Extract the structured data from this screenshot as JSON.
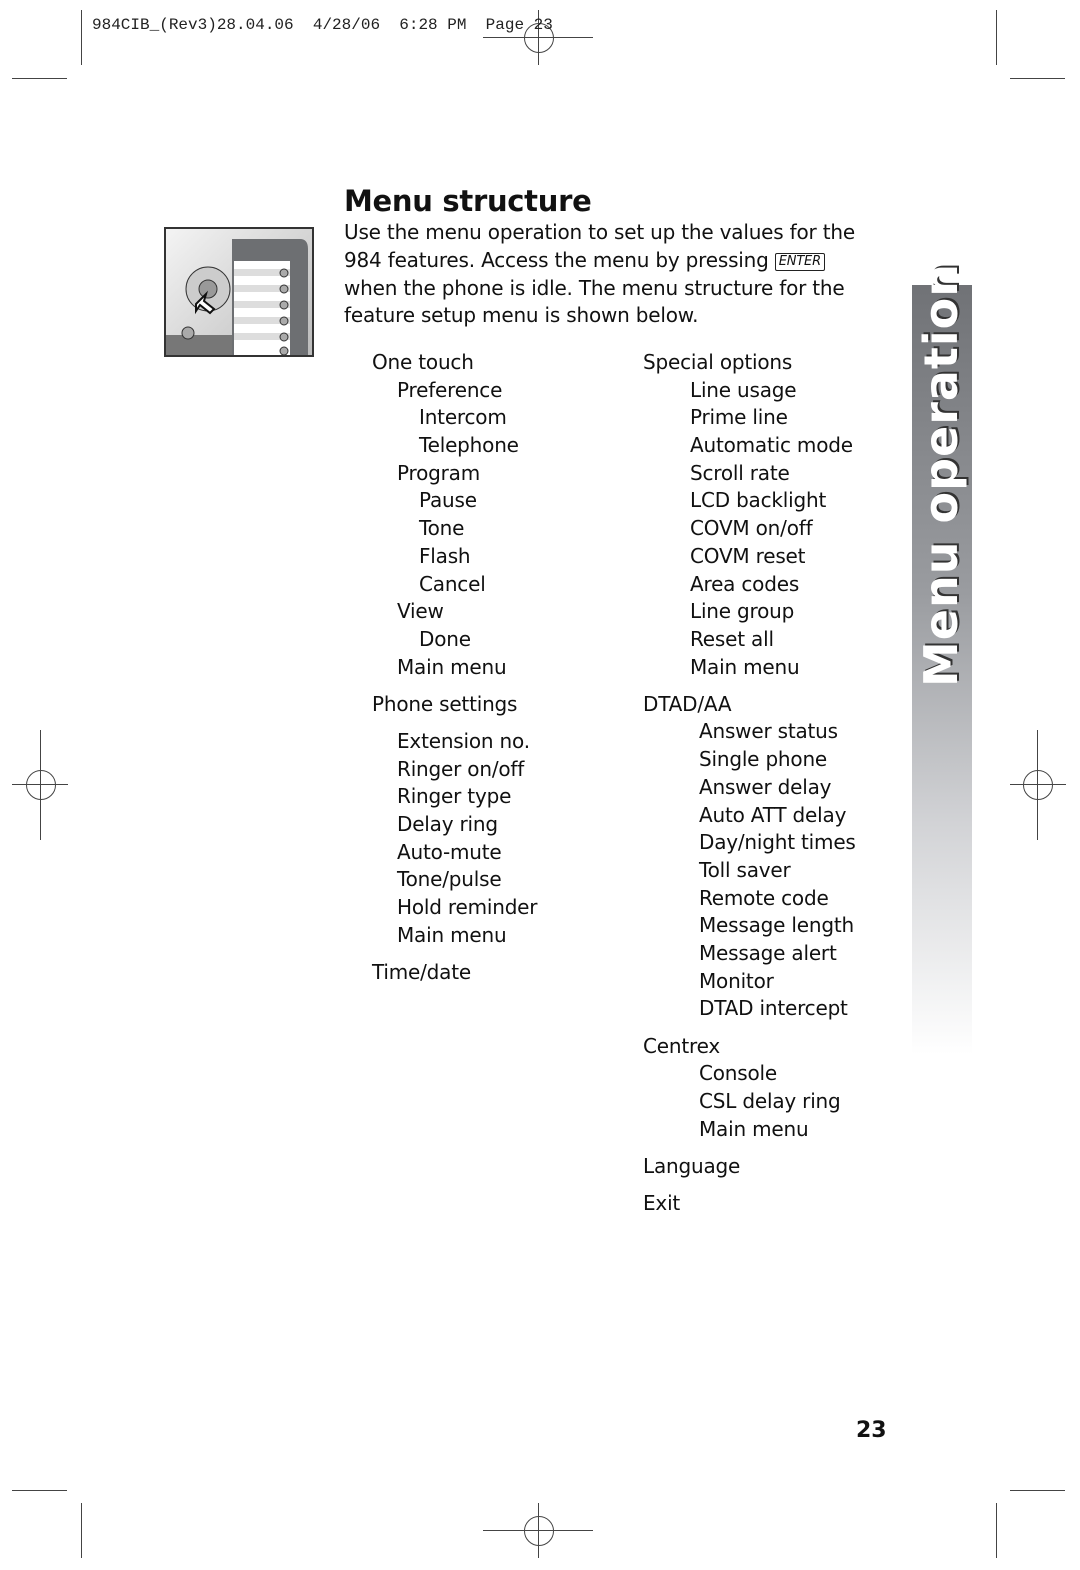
{
  "slug": "984CIB_(Rev3)28.04.06  4/28/06  6:28 PM  Page 23",
  "title": "Menu structure",
  "intro": {
    "before": "Use the menu operation to set up the values for the 984 features. Access the menu by pressing ",
    "key": "ENTER",
    "after": " when the phone is idle. The menu structure for the feature setup menu is shown below."
  },
  "left_menu": [
    {
      "label": "One touch",
      "level": 0
    },
    {
      "label": "Preference",
      "level": 1
    },
    {
      "label": "Intercom",
      "level": 2
    },
    {
      "label": "Telephone",
      "level": 2
    },
    {
      "label": "Program",
      "level": 1
    },
    {
      "label": "Pause",
      "level": 2
    },
    {
      "label": "Tone",
      "level": 2
    },
    {
      "label": "Flash",
      "level": 2
    },
    {
      "label": "Cancel",
      "level": 2
    },
    {
      "label": "View",
      "level": 1
    },
    {
      "label": "Done",
      "level": 2
    },
    {
      "label": "Main menu",
      "level": 1
    },
    {
      "label": "Phone settings",
      "level": 0
    },
    {
      "label": "Extension no.",
      "level": 1
    },
    {
      "label": "Ringer on/off",
      "level": 1
    },
    {
      "label": "Ringer type",
      "level": 1
    },
    {
      "label": "Delay ring",
      "level": 1
    },
    {
      "label": "Auto-mute",
      "level": 1
    },
    {
      "label": "Tone/pulse",
      "level": 1
    },
    {
      "label": "Hold reminder",
      "level": 1
    },
    {
      "label": "Main menu",
      "level": 1
    },
    {
      "label": "Time/date",
      "level": 0
    }
  ],
  "right_menu": [
    {
      "label": "Special options",
      "level": 0
    },
    {
      "label": "Line usage",
      "level": 1
    },
    {
      "label": "Prime line",
      "level": 1
    },
    {
      "label": "Automatic mode",
      "level": 1
    },
    {
      "label": "Scroll rate",
      "level": 1
    },
    {
      "label": "LCD backlight",
      "level": 1
    },
    {
      "label": "COVM on/off",
      "level": 1
    },
    {
      "label": "COVM reset",
      "level": 1
    },
    {
      "label": "Area codes",
      "level": 1
    },
    {
      "label": "Line group",
      "level": 1
    },
    {
      "label": "Reset all",
      "level": 1
    },
    {
      "label": "Main menu",
      "level": 1
    },
    {
      "label": "DTAD/AA",
      "level": 0
    },
    {
      "label": "Answer status",
      "level": 2
    },
    {
      "label": "Single phone",
      "level": 2
    },
    {
      "label": "Answer delay",
      "level": 2
    },
    {
      "label": "Auto ATT delay",
      "level": 2
    },
    {
      "label": "Day/night times",
      "level": 2
    },
    {
      "label": "Toll saver",
      "level": 2
    },
    {
      "label": "Remote code",
      "level": 2
    },
    {
      "label": "Message length",
      "level": 2
    },
    {
      "label": "Message alert",
      "level": 2
    },
    {
      "label": "Monitor",
      "level": 2
    },
    {
      "label": "DTAD intercept",
      "level": 2
    },
    {
      "label": "Centrex",
      "level": 0
    },
    {
      "label": "Console",
      "level": 2
    },
    {
      "label": "CSL delay ring",
      "level": 2
    },
    {
      "label": "Main menu",
      "level": 2
    },
    {
      "label": "Language",
      "level": 0
    },
    {
      "label": "Exit",
      "level": 0
    }
  ],
  "side_tab": "Menu operation",
  "page_number": "23"
}
